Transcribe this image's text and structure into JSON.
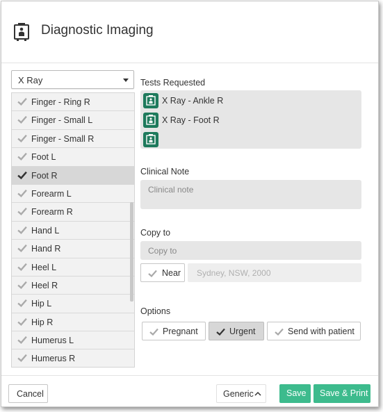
{
  "header": {
    "title": "Diagnostic Imaging",
    "icon": "xray-machine-icon"
  },
  "modality_select": {
    "value": "X Ray"
  },
  "body_parts": [
    {
      "label": "Finger - Ring R",
      "selected": false
    },
    {
      "label": "Finger - Small L",
      "selected": false
    },
    {
      "label": "Finger - Small R",
      "selected": false
    },
    {
      "label": "Foot L",
      "selected": false
    },
    {
      "label": "Foot R",
      "selected": true
    },
    {
      "label": "Forearm L",
      "selected": false
    },
    {
      "label": "Forearm R",
      "selected": false
    },
    {
      "label": "Hand L",
      "selected": false
    },
    {
      "label": "Hand R",
      "selected": false
    },
    {
      "label": "Heel L",
      "selected": false
    },
    {
      "label": "Heel R",
      "selected": false
    },
    {
      "label": "Hip L",
      "selected": false
    },
    {
      "label": "Hip R",
      "selected": false
    },
    {
      "label": "Humerus L",
      "selected": false
    },
    {
      "label": "Humerus R",
      "selected": false
    }
  ],
  "tests": {
    "label": "Tests Requested",
    "items": [
      "X Ray - Ankle R",
      "X Ray - Foot R",
      ""
    ]
  },
  "clinical_note": {
    "label": "Clinical Note",
    "placeholder": "Clinical note"
  },
  "copy_to": {
    "label": "Copy to",
    "placeholder": "Copy to",
    "near_label": "Near",
    "location_placeholder": "Sydney, NSW, 2000"
  },
  "options": {
    "label": "Options",
    "pregnant": "Pregnant",
    "urgent": "Urgent",
    "send_with_patient": "Send with patient"
  },
  "footer": {
    "cancel": "Cancel",
    "generic": "Generic",
    "save": "Save",
    "save_print": "Save & Print"
  },
  "colors": {
    "accent_green": "#3dbb8d",
    "icon_green": "#1e7a5c",
    "check_gray": "#aaaaaa",
    "check_dark": "#333333"
  }
}
